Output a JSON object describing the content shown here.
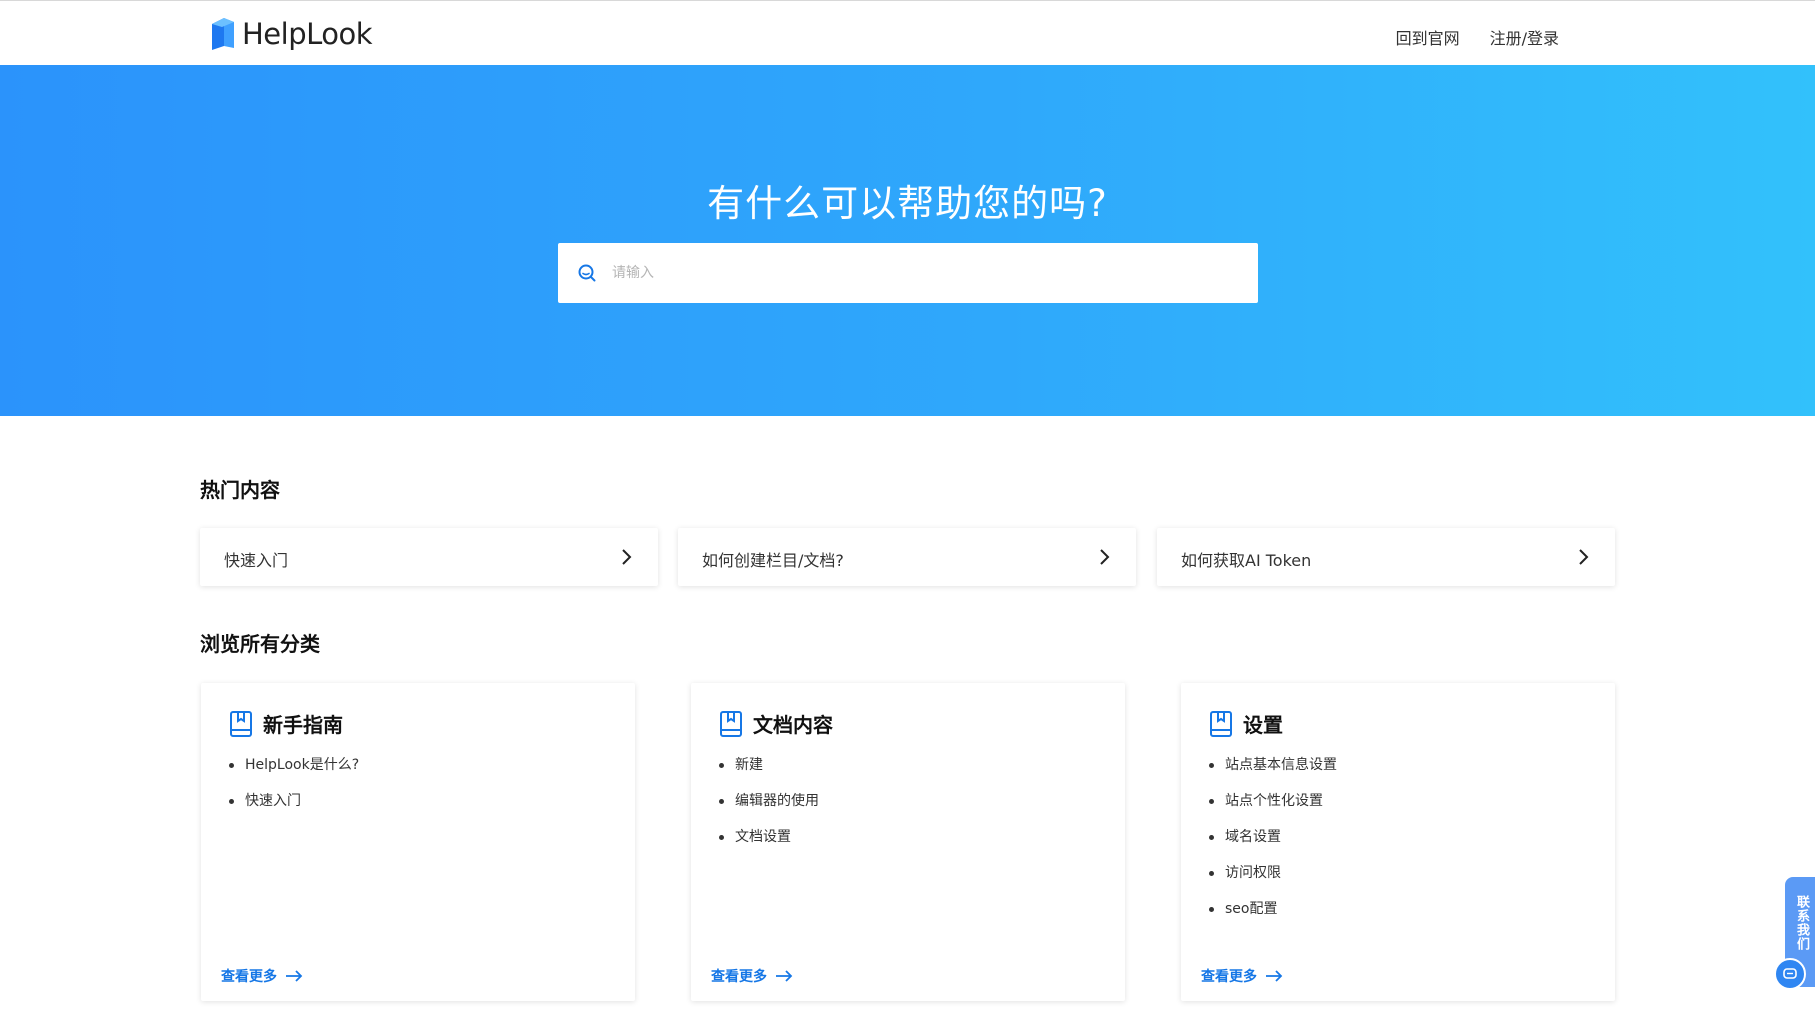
{
  "header": {
    "logo_text": "HelpLook",
    "nav": [
      "回到官网",
      "注册/登录"
    ]
  },
  "hero": {
    "title": "有什么可以帮助您的吗?",
    "search_placeholder": "请输入"
  },
  "hot": {
    "title": "热门内容",
    "items": [
      {
        "label": "快速入门"
      },
      {
        "label": "如何创建栏目/文档?"
      },
      {
        "label": "如何获取AI Token"
      }
    ]
  },
  "categories": {
    "title": "浏览所有分类",
    "cards": [
      {
        "name": "新手指南",
        "items": [
          "HelpLook是什么?",
          "快速入门"
        ],
        "more": "查看更多"
      },
      {
        "name": "文档内容",
        "items": [
          "新建",
          "编辑器的使用",
          "文档设置"
        ],
        "more": "查看更多"
      },
      {
        "name": "设置",
        "items": [
          "站点基本信息设置",
          "站点个性化设置",
          "域名设置",
          "访问权限",
          "seo配置"
        ],
        "more": "查看更多"
      }
    ]
  },
  "float_widget": {
    "label": "联系我们"
  },
  "colors": {
    "accent": "#1677e6",
    "hero_start": "#2b93fb",
    "hero_end": "#32c1fb"
  }
}
